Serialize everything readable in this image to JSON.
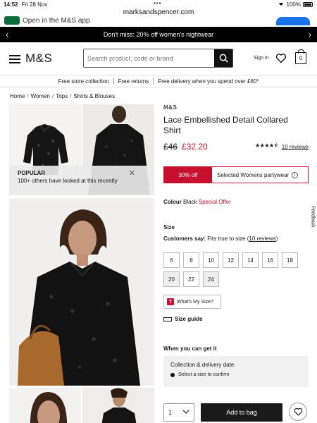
{
  "status_bar": {
    "time": "14:52",
    "date": "Fri 28 Nov",
    "battery": "100%"
  },
  "browser": {
    "url": "marksandspencer.com",
    "app_banner": "Open in the M&S app"
  },
  "promo": {
    "text": "Don't miss: 20% off women's nightwear"
  },
  "header": {
    "logo": "M&S",
    "search_placeholder": "Search product, code or brand",
    "sign_in": "Sign in",
    "bag_count": "0"
  },
  "usps": [
    "Free store collection",
    "Free returns",
    "Free delivery when you spend over £60*"
  ],
  "breadcrumb": [
    "Home",
    "Women",
    "Tops",
    "Shirts & Blouses"
  ],
  "popular": {
    "title": "POPULAR",
    "text": "100+ others have looked at this recently"
  },
  "product": {
    "brand": "M&S",
    "name": "Lace Embellished Detail Collared Shirt",
    "was_price": "£46",
    "now_price": "£32.20",
    "rating": 4.5,
    "reviews_link": "10 reviews",
    "offer_pct": "30% off",
    "offer_label": "Selected Womens partywear",
    "colour_label": "Colour",
    "colour_value": "Black",
    "colour_offer": "Special Offer",
    "size_heading": "Size",
    "customers_say_label": "Customers say:",
    "customers_say_value": "Fits true to size",
    "customers_say_link": "10 reviews",
    "sizes": [
      {
        "label": "6",
        "available": true
      },
      {
        "label": "8",
        "available": true
      },
      {
        "label": "10",
        "available": true
      },
      {
        "label": "12",
        "available": true
      },
      {
        "label": "14",
        "available": true
      },
      {
        "label": "16",
        "available": true
      },
      {
        "label": "18",
        "available": true
      },
      {
        "label": "20",
        "available": false
      },
      {
        "label": "22",
        "available": true
      },
      {
        "label": "24",
        "available": false
      }
    ],
    "whats_my_size": "What's My Size?",
    "size_guide": "Size guide",
    "when_heading": "When you can get it",
    "collection_title": "Collection & delivery date",
    "collection_hint": "Select a size to confirm",
    "quantity": "1",
    "add_to_bag": "Add to bag"
  },
  "feedback_tab": "Feedback",
  "colors": {
    "accent_red": "#c8102e",
    "black": "#1a1a1a"
  }
}
